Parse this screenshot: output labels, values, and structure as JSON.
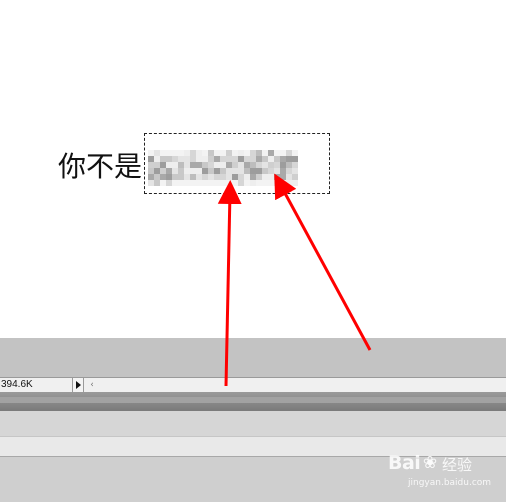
{
  "canvas": {
    "text": "你不是",
    "selection_tool": "marquee-selection"
  },
  "status_bar": {
    "doc_size": "394.6K",
    "menu_icon": "triangle-right-icon",
    "scroll_icon": "chevron-left-icon"
  },
  "watermark": {
    "brand": "Bai",
    "paw_icon": "paw-icon",
    "suffix": "经验",
    "url": "jingyan.baidu.com"
  },
  "annotations": {
    "arrow_color": "#ff0000"
  },
  "colors": {
    "canvas_bg": "#ffffff",
    "workspace_gray": "#c3c3c3",
    "status_bar_bg": "#f0f0f0"
  }
}
